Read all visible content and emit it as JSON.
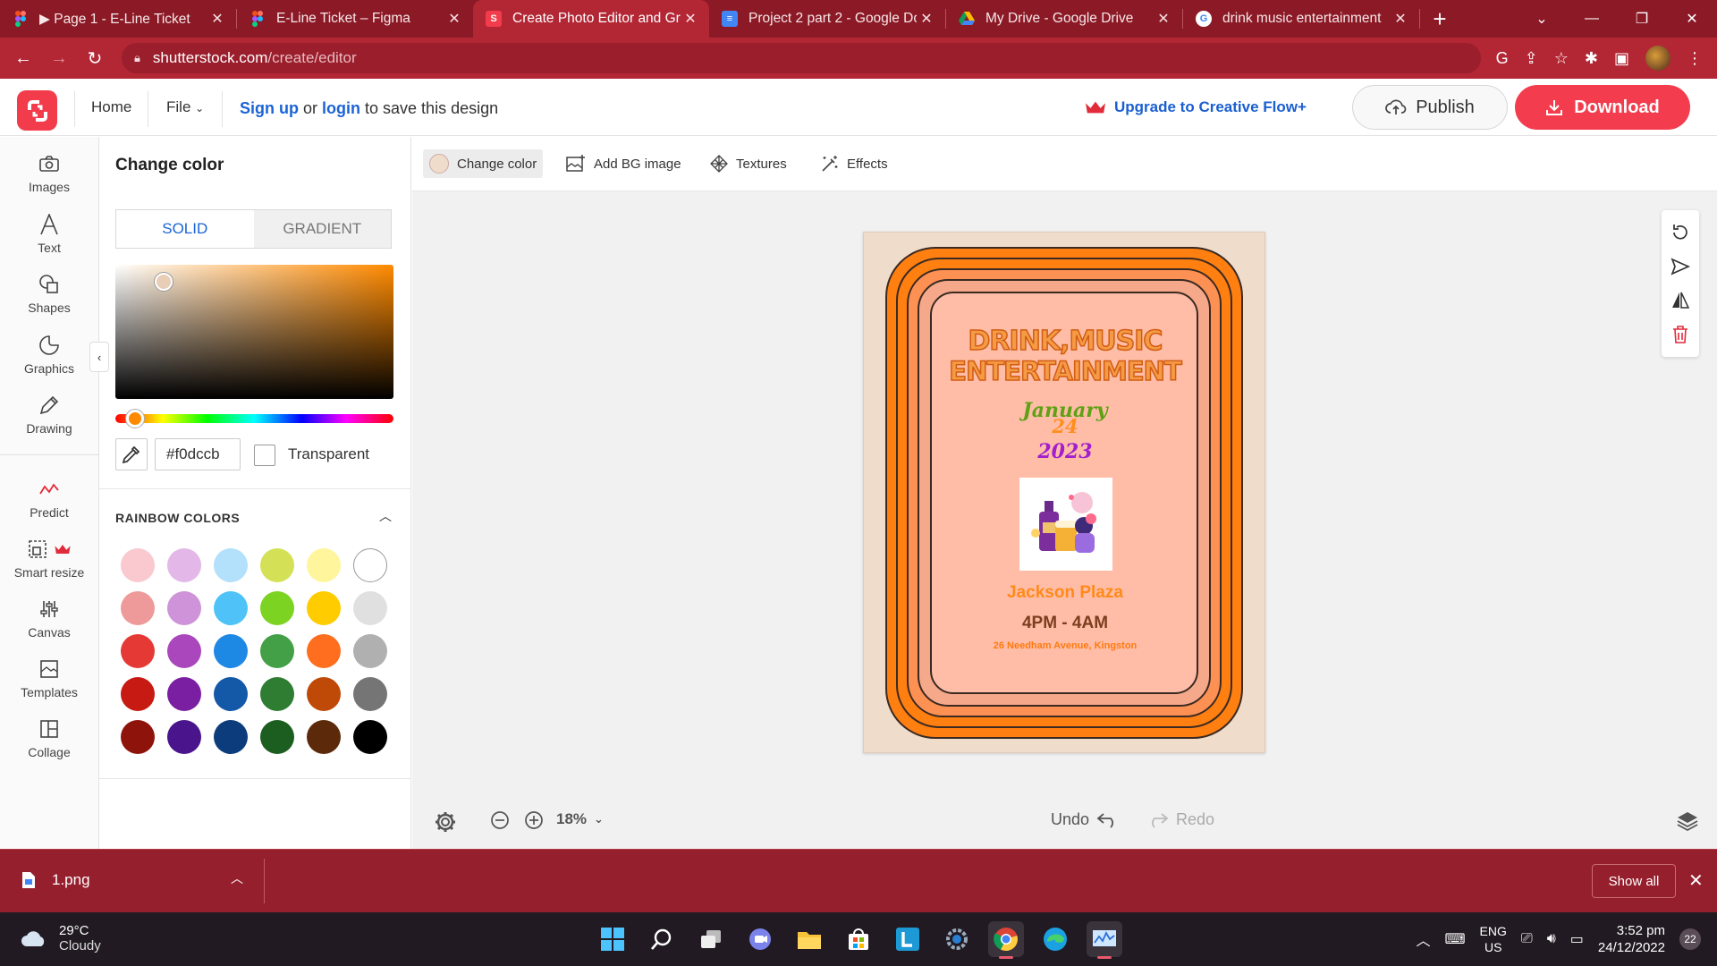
{
  "browser": {
    "tabs": [
      {
        "title": "▶ Page 1 - E-Line Ticket",
        "favicon": "figma-icon",
        "active": false
      },
      {
        "title": "E-Line Ticket – Figma",
        "favicon": "figma-icon",
        "active": false
      },
      {
        "title": "Create Photo Editor and Gr",
        "favicon": "shutterstock-icon",
        "active": true
      },
      {
        "title": "Project 2 part 2 - Google Do",
        "favicon": "google-docs-icon",
        "active": false
      },
      {
        "title": "My Drive - Google Drive",
        "favicon": "google-drive-icon",
        "active": false
      },
      {
        "title": "drink music entertainment",
        "favicon": "google-icon",
        "active": false
      }
    ],
    "url_host": "shutterstock.com",
    "url_path": "/create/editor"
  },
  "header": {
    "home": "Home",
    "file": "File",
    "sign_up": "Sign up",
    "or": " or ",
    "login": "login",
    "save_suffix": " to save this design",
    "upgrade": "Upgrade to Creative Flow+",
    "publish": "Publish",
    "download": "Download"
  },
  "rail": {
    "images": "Images",
    "text": "Text",
    "shapes": "Shapes",
    "graphics": "Graphics",
    "drawing": "Drawing",
    "predict": "Predict",
    "smart_resize": "Smart resize",
    "canvas": "Canvas",
    "templates": "Templates",
    "collage": "Collage"
  },
  "panel": {
    "title": "Change color",
    "tab_solid": "SOLID",
    "tab_gradient": "GRADIENT",
    "hex_value": "#f0dccb",
    "transparent": "Transparent",
    "section": "RAINBOW COLORS",
    "swatches": [
      "#f9c9cf",
      "#e3b8e8",
      "#b3e0fb",
      "#d4e157",
      "#fff59d",
      "#ffffff",
      "#ef9a9a",
      "#ce93d8",
      "#4fc3f7",
      "#7cd321",
      "#ffcc00",
      "#e0e0e0",
      "#e53935",
      "#ab47bc",
      "#1e88e5",
      "#43a047",
      "#ff6d1f",
      "#b0b0b0",
      "#c61a12",
      "#7b1fa2",
      "#1458a8",
      "#2e7d32",
      "#bf4a08",
      "#757575",
      "#8e130b",
      "#4a148c",
      "#0d3c7d",
      "#1b5e20",
      "#5c2a0a",
      "#000000"
    ]
  },
  "canvas_toolbar": {
    "change_color": "Change color",
    "add_bg": "Add BG image",
    "textures": "Textures",
    "effects": "Effects"
  },
  "poster": {
    "headline1": "DRINK,MUSIC",
    "headline2": "ENTERTAINMENT",
    "month": "January",
    "day": "24",
    "year": "2023",
    "venue": "Jackson Plaza",
    "time": "4PM - 4AM",
    "address": "26 Needham Avenue, Kingston"
  },
  "bottom": {
    "zoom": "18%",
    "undo": "Undo",
    "redo": "Redo"
  },
  "downloads": {
    "file": "1.png",
    "show_all": "Show all"
  },
  "taskbar": {
    "temp": "29°C",
    "condition": "Cloudy",
    "lang1": "ENG",
    "lang2": "US",
    "time": "3:52 pm",
    "date": "24/12/2022",
    "notifications": "22"
  },
  "colors": {
    "accent": "#f33c4d",
    "link": "#1a64d6",
    "browser_frame": "#8b1a26",
    "poster_bg": "#f0dccb",
    "poster_orange": "#ff7f11",
    "poster_salmon": "#ffbda8"
  }
}
